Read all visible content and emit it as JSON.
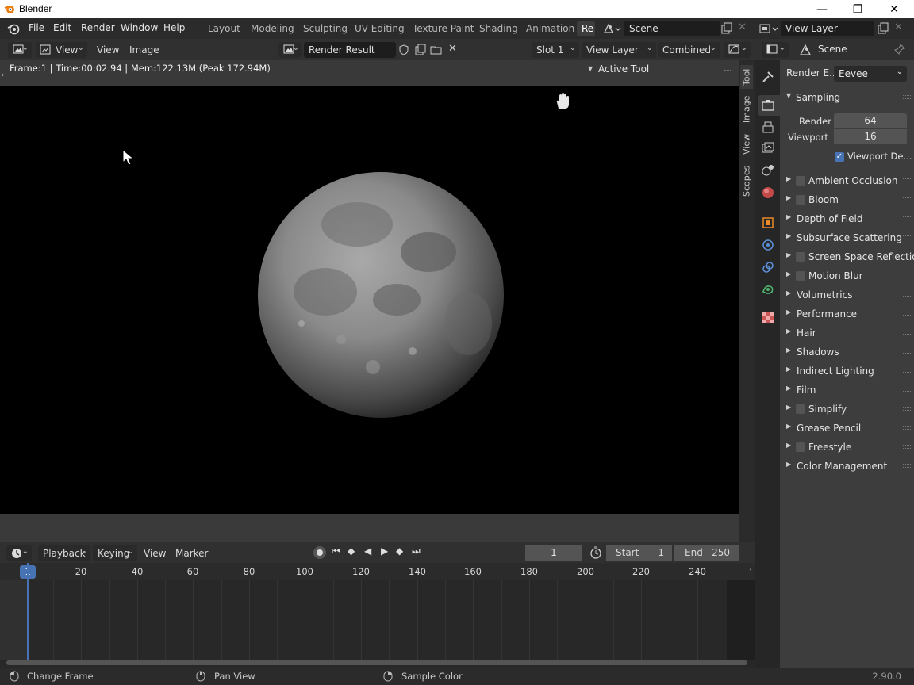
{
  "window": {
    "title": "Blender",
    "min": "—",
    "restore": "❐",
    "close": "✕"
  },
  "menu": {
    "items": [
      "File",
      "Edit",
      "Render",
      "Window",
      "Help"
    ]
  },
  "workspaces": [
    "Layout",
    "Modeling",
    "Sculpting",
    "UV Editing",
    "Texture Paint",
    "Shading",
    "Animation",
    "Re"
  ],
  "scene": {
    "name": "Scene"
  },
  "view_layer": {
    "name": "View Layer"
  },
  "image_editor": {
    "view_mode": "View",
    "menus": [
      "View",
      "Image"
    ],
    "image_name": "Render Result",
    "slot": "Slot 1",
    "layer": "View Layer",
    "pass": "Combined",
    "info": "Frame:1 | Time:00:02.94 | Mem:122.13M (Peak 172.94M)",
    "active_tool": "Active Tool",
    "side_tabs": [
      "Tool",
      "Image",
      "View",
      "Scopes"
    ]
  },
  "timeline": {
    "menus": [
      "Playback",
      "Keying",
      "View",
      "Marker"
    ],
    "current_frame": "1",
    "start_label": "Start",
    "start": "1",
    "end_label": "End",
    "end": "250",
    "ticks": [
      "20",
      "40",
      "60",
      "80",
      "100",
      "120",
      "140",
      "160",
      "180",
      "200",
      "220",
      "240"
    ]
  },
  "properties": {
    "context": "Scene",
    "render_engine_label": "Render E...",
    "render_engine": "Eevee",
    "sampling": {
      "title": "Sampling",
      "render_label": "Render",
      "render": "64",
      "viewport_label": "Viewport",
      "viewport": "16",
      "denoise": "Viewport De..."
    },
    "panels": [
      {
        "label": "Ambient Occlusion",
        "checkbox": true
      },
      {
        "label": "Bloom",
        "checkbox": true
      },
      {
        "label": "Depth of Field",
        "checkbox": false
      },
      {
        "label": "Subsurface Scattering",
        "checkbox": false
      },
      {
        "label": "Screen Space Reflections",
        "checkbox": true
      },
      {
        "label": "Motion Blur",
        "checkbox": true
      },
      {
        "label": "Volumetrics",
        "checkbox": false
      },
      {
        "label": "Performance",
        "checkbox": false
      },
      {
        "label": "Hair",
        "checkbox": false
      },
      {
        "label": "Shadows",
        "checkbox": false
      },
      {
        "label": "Indirect Lighting",
        "checkbox": false
      },
      {
        "label": "Film",
        "checkbox": false
      },
      {
        "label": "Simplify",
        "checkbox": true
      },
      {
        "label": "Grease Pencil",
        "checkbox": false
      },
      {
        "label": "Freestyle",
        "checkbox": true
      },
      {
        "label": "Color Management",
        "checkbox": false
      }
    ]
  },
  "status": {
    "left": "Change Frame",
    "middle": "Pan View",
    "right": "Sample Color",
    "version": "2.90.0"
  },
  "colors": {
    "accent": "#4772b3",
    "panel_bg": "#3d3d3d",
    "header_bg": "#303030"
  }
}
